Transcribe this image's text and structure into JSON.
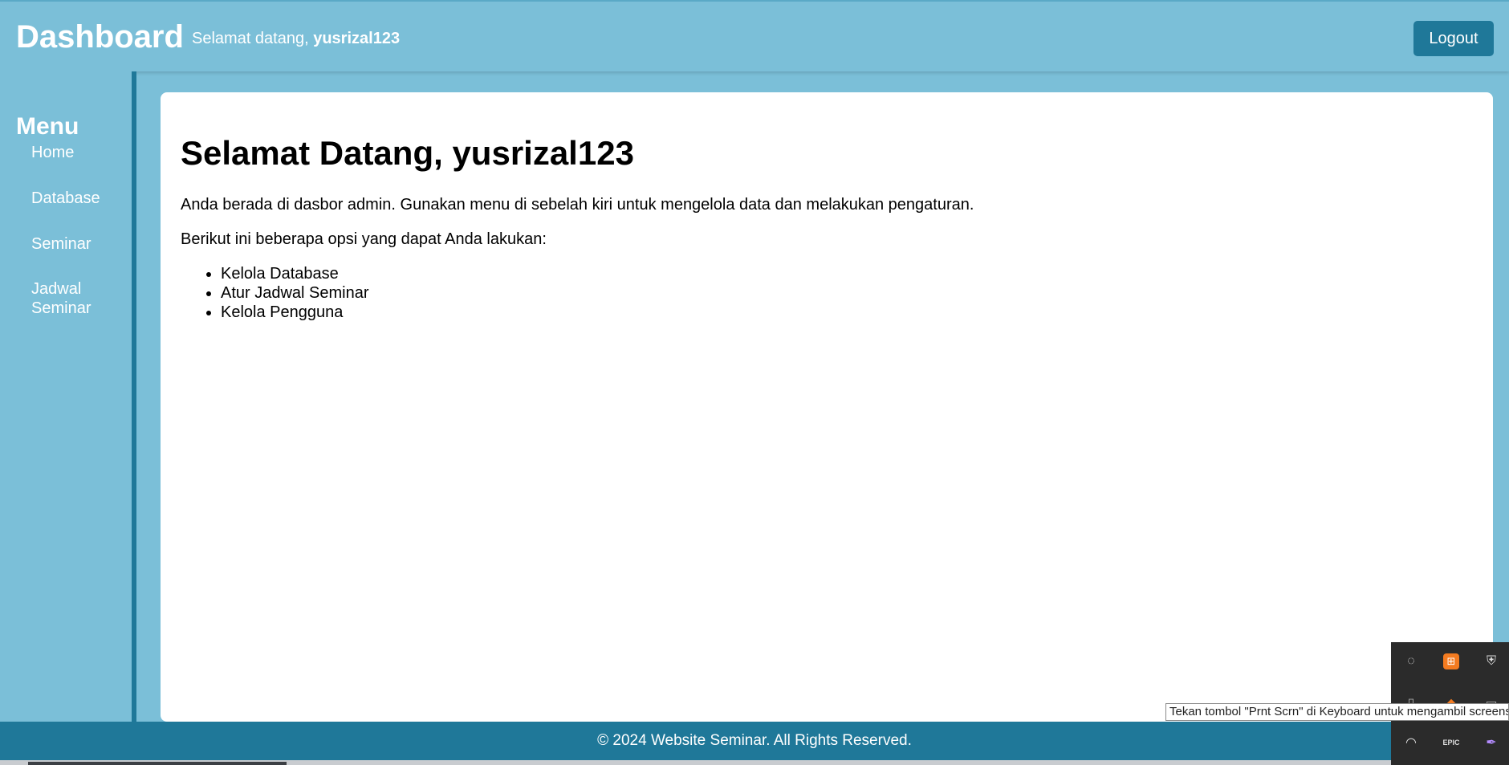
{
  "header": {
    "brand": "Dashboard",
    "welcome_prefix": "Selamat datang,",
    "username": "yusrizal123",
    "logout_label": "Logout"
  },
  "sidebar": {
    "title": "Menu",
    "items": [
      {
        "label": "Home"
      },
      {
        "label": "Database"
      },
      {
        "label": "Seminar"
      },
      {
        "label": "Jadwal Seminar"
      }
    ]
  },
  "main": {
    "heading": "Selamat Datang, yusrizal123",
    "intro": "Anda berada di dasbor admin. Gunakan menu di sebelah kiri untuk mengelola data dan melakukan pengaturan.",
    "options_intro": "Berikut ini beberapa opsi yang dapat Anda lakukan:",
    "options": [
      "Kelola Database",
      "Atur Jadwal Seminar",
      "Kelola Pengguna"
    ]
  },
  "footer": {
    "text": "© 2024 Website Seminar. All Rights Reserved."
  },
  "tooltip": {
    "text": "Tekan tombol \"Prnt Scrn\" di Keyboard untuk mengambil screens"
  },
  "tray": {
    "icons": [
      "circle-icon",
      "xampp-icon",
      "shield-icon",
      "usb-icon",
      "sublime-icon",
      "window-icon",
      "wifi-icon",
      "epic-games-icon",
      "pen-icon"
    ]
  },
  "colors": {
    "background": "#7bbfd8",
    "accent": "#1f7899",
    "content": "#ffffff"
  }
}
